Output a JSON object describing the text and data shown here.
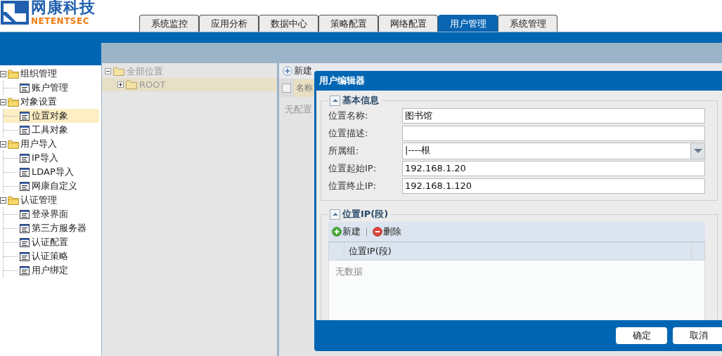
{
  "brand": {
    "name": "网康科技",
    "sub": "NETENTSEC"
  },
  "tabs": [
    {
      "label": "系统监控",
      "selected": false
    },
    {
      "label": "应用分析",
      "selected": false
    },
    {
      "label": "数据中心",
      "selected": false
    },
    {
      "label": "策略配置",
      "selected": false
    },
    {
      "label": "网络配置",
      "selected": false
    },
    {
      "label": "用户管理",
      "selected": true
    },
    {
      "label": "系统管理",
      "selected": false
    }
  ],
  "sidebar": {
    "items": [
      {
        "label": "组织管理",
        "expanded": true,
        "selected": false,
        "children": [
          {
            "label": "账户管理",
            "selected": false
          }
        ]
      },
      {
        "label": "对象设置",
        "expanded": true,
        "selected": false,
        "children": [
          {
            "label": "位置对象",
            "selected": true
          },
          {
            "label": "工具对象",
            "selected": false
          }
        ]
      },
      {
        "label": "用户导入",
        "expanded": true,
        "selected": false,
        "children": [
          {
            "label": "IP导入",
            "selected": false
          },
          {
            "label": "LDAP导入",
            "selected": false
          },
          {
            "label": "网康自定义",
            "selected": false
          }
        ]
      },
      {
        "label": "认证管理",
        "expanded": true,
        "selected": false,
        "children": [
          {
            "label": "登录界面",
            "selected": false
          },
          {
            "label": "第三方服务器",
            "selected": false
          },
          {
            "label": "认证配置",
            "selected": false
          },
          {
            "label": "认证策略",
            "selected": false
          },
          {
            "label": "用户绑定",
            "selected": false
          }
        ]
      }
    ]
  },
  "location_tree": {
    "items": [
      {
        "label": "全部位置",
        "expanded": true,
        "selected": false,
        "children": [
          {
            "label": "ROOT",
            "expanded": false,
            "selected": true
          }
        ]
      }
    ]
  },
  "toolbar": {
    "buttons": [
      "新建"
    ]
  },
  "grid": {
    "select_all_checked": false,
    "columns": [
      "名称"
    ],
    "empty_text": "无配置"
  },
  "dialog": {
    "title": "用户编辑器",
    "basic": {
      "title": "基本信息",
      "expanded": true,
      "fields": [
        {
          "label": "位置名称:",
          "kind": "text",
          "value": "图书馆"
        },
        {
          "label": "位置描述:",
          "kind": "text"
        },
        {
          "label": "所属组:",
          "kind": "select",
          "value": "|----根"
        },
        {
          "label": "位置起始IP:",
          "kind": "text",
          "value": "192.168.1.20"
        },
        {
          "label": "位置终止IP:",
          "kind": "text",
          "value": "192.168.1.120"
        }
      ]
    },
    "ip_section": {
      "title": "位置IP(段)",
      "expanded": true,
      "toolbar": [
        {
          "label": "新建",
          "kind": "add"
        },
        {
          "label": "删除",
          "kind": "delete"
        }
      ],
      "columns": [
        "位置IP(段)"
      ],
      "empty_text": "无数据"
    },
    "buttons": [
      "确定",
      "取消"
    ]
  }
}
